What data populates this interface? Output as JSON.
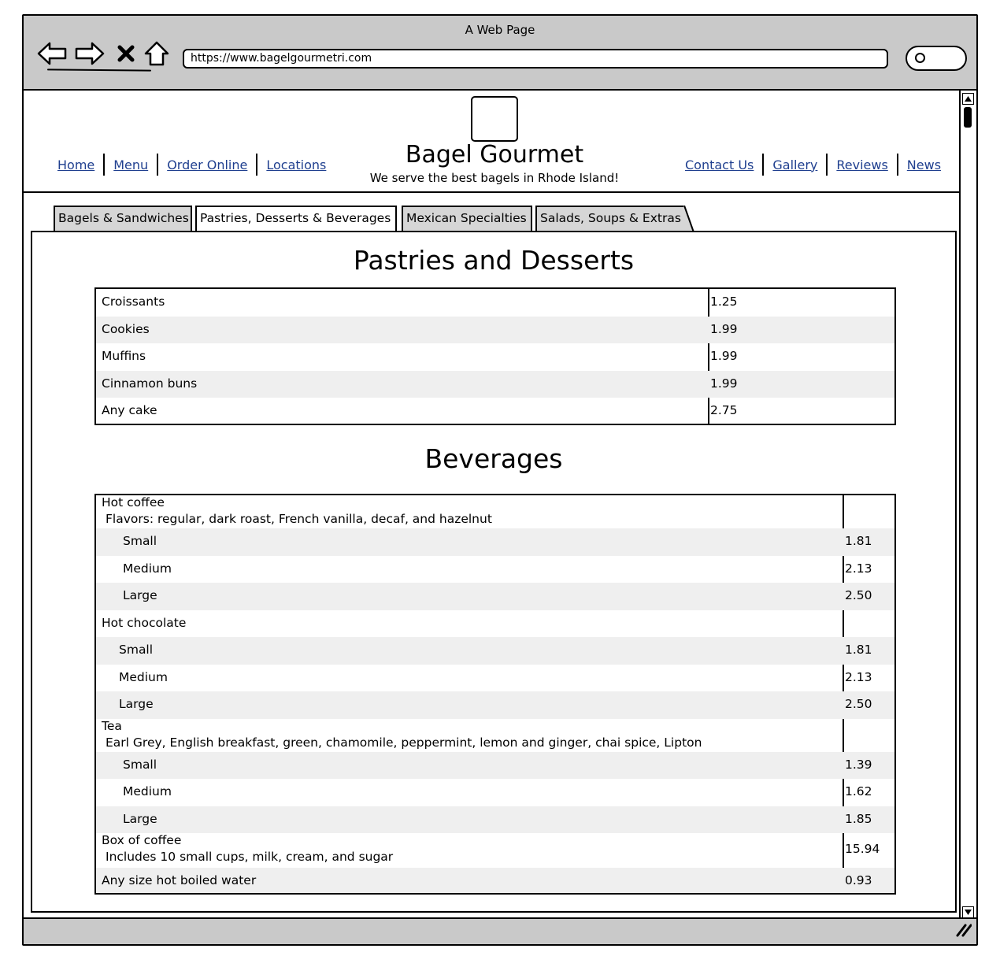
{
  "window": {
    "title": "A Web Page",
    "url": "https://www.bagelgourmetri.com"
  },
  "site": {
    "title": "Bagel Gourmet",
    "tagline": "We serve the best bagels in Rhode Island!"
  },
  "nav_left": [
    "Home",
    "Menu",
    "Order Online",
    "Locations"
  ],
  "nav_right": [
    "Contact Us",
    "Gallery",
    "Reviews",
    "News"
  ],
  "tabs": [
    {
      "label": "Bagels & Sandwiches",
      "active": false
    },
    {
      "label": "Pastries, Desserts & Beverages",
      "active": true
    },
    {
      "label": "Mexican Specialties",
      "active": false
    },
    {
      "label": "Salads, Soups & Extras",
      "active": false
    }
  ],
  "pastries": {
    "title": "Pastries and Desserts",
    "items": [
      {
        "name": "Croissants",
        "price": "1.25"
      },
      {
        "name": "Cookies",
        "price": "1.99"
      },
      {
        "name": "Muffins",
        "price": "1.99"
      },
      {
        "name": "Cinnamon buns",
        "price": "1.99"
      },
      {
        "name": "Any cake",
        "price": "2.75"
      }
    ]
  },
  "beverages": {
    "title": "Beverages",
    "rows": [
      {
        "name": "Hot coffee",
        "sub": "Flavors: regular, dark roast, French vanilla, decaf, and hazelnut",
        "price": ""
      },
      {
        "name": "Small",
        "price": "1.81",
        "indent": true
      },
      {
        "name": "Medium",
        "price": "2.13",
        "indent": true
      },
      {
        "name": "Large",
        "price": "2.50",
        "indent": true
      },
      {
        "name": "Hot chocolate",
        "price": ""
      },
      {
        "name": "Small",
        "price": "1.81",
        "indent": true
      },
      {
        "name": "Medium",
        "price": "2.13",
        "indent": true
      },
      {
        "name": "Large",
        "price": "2.50",
        "indent": true
      },
      {
        "name": "Tea",
        "sub": "Earl Grey, English breakfast, green, chamomile, peppermint, lemon and ginger, chai spice, Lipton",
        "price": ""
      },
      {
        "name": "Small",
        "price": "1.39",
        "indent": true
      },
      {
        "name": "Medium",
        "price": "1.62",
        "indent": true
      },
      {
        "name": "Large",
        "price": "1.85",
        "indent": true
      },
      {
        "name": "Box of coffee",
        "sub": "Includes 10 small cups, milk, cream, and sugar",
        "price": "15.94"
      },
      {
        "name": "Any size hot boiled water",
        "price": "0.93"
      }
    ]
  }
}
